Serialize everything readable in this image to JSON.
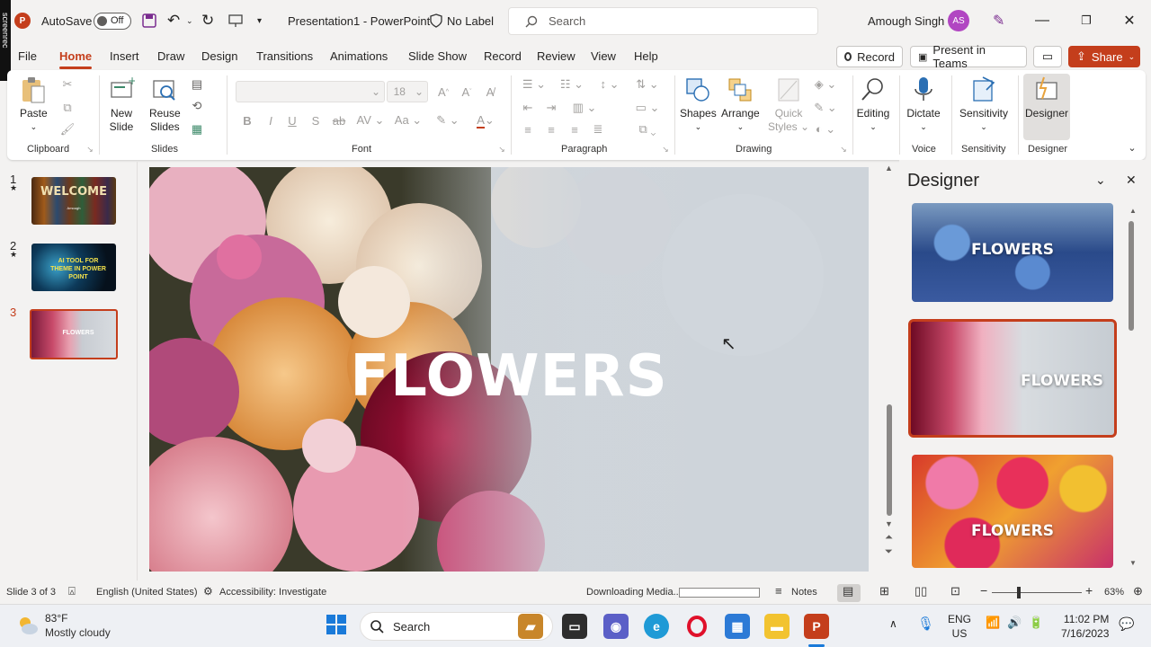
{
  "titlebar": {
    "autosave_label": "AutoSave",
    "autosave_state": "Off",
    "document_title": "Presentation1 -  PowerPoint",
    "sensitivity_label": "No Label",
    "search_placeholder": "Search",
    "user_name": "Amough Singh",
    "user_initials": "AS",
    "watermark": "screenrec"
  },
  "menu": {
    "tabs": [
      "File",
      "Home",
      "Insert",
      "Draw",
      "Design",
      "Transitions",
      "Animations",
      "Slide Show",
      "Record",
      "Review",
      "View",
      "Help"
    ],
    "active": "Home",
    "record_button": "Record",
    "present_teams_button": "Present in Teams",
    "share_button": "Share"
  },
  "ribbon": {
    "clipboard": {
      "paste": "Paste",
      "group": "Clipboard"
    },
    "slides": {
      "new_slide_1": "New",
      "new_slide_2": "Slide",
      "reuse_1": "Reuse",
      "reuse_2": "Slides",
      "group": "Slides"
    },
    "font": {
      "size": "18",
      "group": "Font"
    },
    "paragraph": {
      "group": "Paragraph"
    },
    "drawing": {
      "shapes": "Shapes",
      "arrange": "Arrange",
      "quick_styles_1": "Quick",
      "quick_styles_2": "Styles",
      "group": "Drawing"
    },
    "editing": {
      "label": "Editing"
    },
    "voice": {
      "dictate": "Dictate",
      "group": "Voice"
    },
    "sensitivity": {
      "label": "Sensitivity",
      "group": "Sensitivity"
    },
    "designer": {
      "label": "Designer",
      "group": "Designer"
    }
  },
  "thumbnails": [
    {
      "number": "1",
      "text": "WELCOME",
      "subtext": "Amough"
    },
    {
      "number": "2",
      "text": "AI TOOL FOR THEME IN POWER POINT"
    },
    {
      "number": "3",
      "text": "FLOWERS"
    }
  ],
  "slide": {
    "title": "FLOWERS"
  },
  "designer_pane": {
    "title": "Designer",
    "designs": [
      "FLOWERS",
      "FLOWERS",
      "FLOWERS"
    ]
  },
  "status": {
    "slide_counter": "Slide 3 of 3",
    "language": "English (United States)",
    "accessibility": "Accessibility: Investigate",
    "downloading": "Downloading Media...",
    "notes": "Notes",
    "zoom": "63%"
  },
  "taskbar": {
    "temperature": "83°F",
    "weather": "Mostly cloudy",
    "search": "Search",
    "lang_1": "ENG",
    "lang_2": "US",
    "time": "11:02 PM",
    "date": "7/16/2023"
  },
  "colors": {
    "accent": "#c43e1c",
    "avatar": "#b146c2"
  }
}
